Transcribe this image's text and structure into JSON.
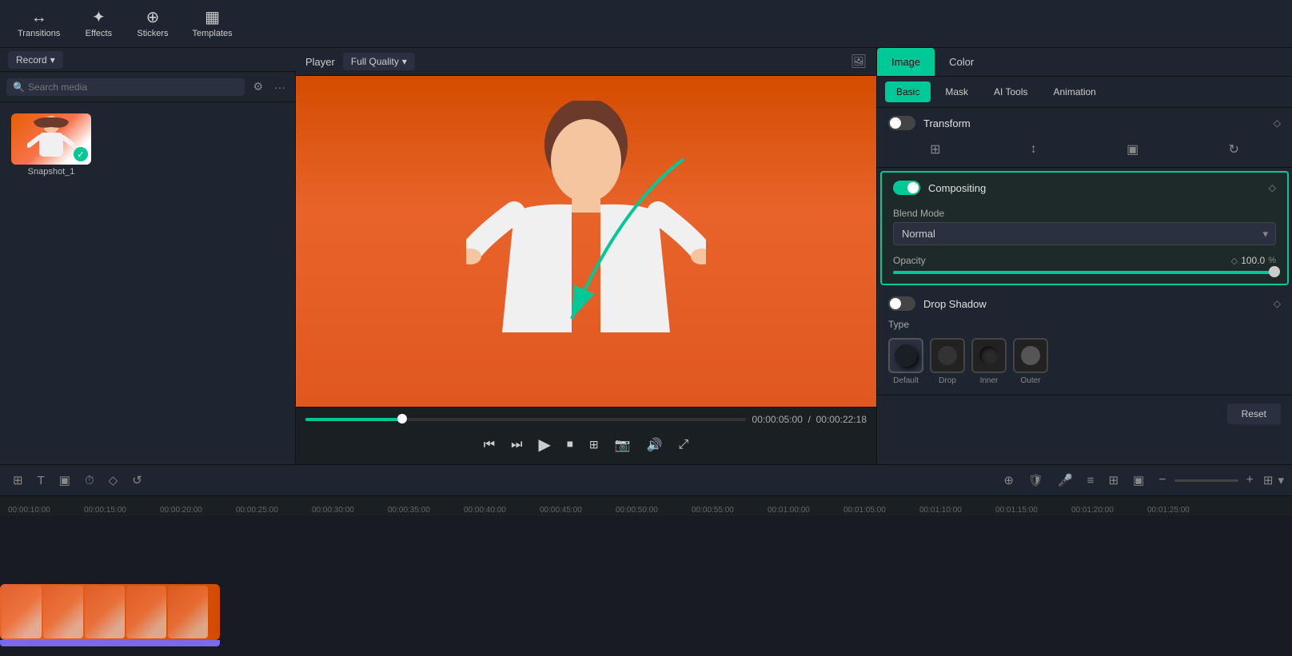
{
  "topNav": {
    "items": [
      {
        "id": "transitions",
        "label": "Transitions",
        "icon": "↔"
      },
      {
        "id": "effects",
        "label": "Effects",
        "icon": "✦"
      },
      {
        "id": "stickers",
        "label": "Stickers",
        "icon": "⊕"
      },
      {
        "id": "templates",
        "label": "Templates",
        "icon": "▦"
      }
    ]
  },
  "leftPanel": {
    "recordLabel": "Record",
    "searchPlaceholder": "Search media",
    "mediaItems": [
      {
        "name": "Snapshot_1",
        "checked": true
      }
    ]
  },
  "playerBar": {
    "playerLabel": "Player",
    "qualityLabel": "Full Quality"
  },
  "playerControls": {
    "currentTime": "00:00:05:00",
    "totalTime": "00:00:22:18",
    "progressPercent": 22
  },
  "rightPanel": {
    "topTabs": [
      {
        "id": "image",
        "label": "Image",
        "active": true
      },
      {
        "id": "color",
        "label": "Color",
        "active": false
      }
    ],
    "subTabs": [
      {
        "id": "basic",
        "label": "Basic",
        "active": true
      },
      {
        "id": "mask",
        "label": "Mask",
        "active": false
      },
      {
        "id": "aitools",
        "label": "AI Tools",
        "active": false
      },
      {
        "id": "animation",
        "label": "Animation",
        "active": false
      }
    ],
    "transform": {
      "title": "Transform",
      "enabled": false
    },
    "compositing": {
      "title": "Compositing",
      "enabled": true,
      "blendModeLabel": "Blend Mode",
      "blendModeValue": "Normal",
      "opacityLabel": "Opacity",
      "opacityValue": "100.0",
      "opacityUnit": "%"
    },
    "dropShadow": {
      "title": "Drop Shadow",
      "enabled": false,
      "typeLabel": "Type",
      "types": [
        {
          "id": "default",
          "label": "Default",
          "active": true
        },
        {
          "id": "drop",
          "label": "Drop",
          "active": false
        },
        {
          "id": "inner",
          "label": "Inner",
          "active": false
        },
        {
          "id": "outer",
          "label": "Outer",
          "active": false
        }
      ]
    },
    "resetLabel": "Reset"
  },
  "timeline": {
    "toolbarBtns": [
      "⊞",
      "T",
      "▣",
      "⏱",
      "◇",
      "↺"
    ],
    "rightBtns": [
      "⊕",
      "🛡",
      "🎤",
      "≡",
      "⊞",
      "▣"
    ],
    "rulerTicks": [
      "00:00:10:00",
      "00:00:15:00",
      "00:00:20:00",
      "00:00:25:00",
      "00:00:30:00",
      "00:00:35:00",
      "00:00:40:00",
      "00:00:45:00",
      "00:00:50:00",
      "00:00:55:00",
      "00:01:00:00",
      "00:01:05:00",
      "00:01:10:00",
      "00:01:15:00",
      "00:01:20:00",
      "00:01:25:00"
    ]
  },
  "colors": {
    "teal": "#00c896",
    "accent": "#00c896",
    "darkBg": "#1a1f24",
    "panelBg": "#1e2530"
  }
}
